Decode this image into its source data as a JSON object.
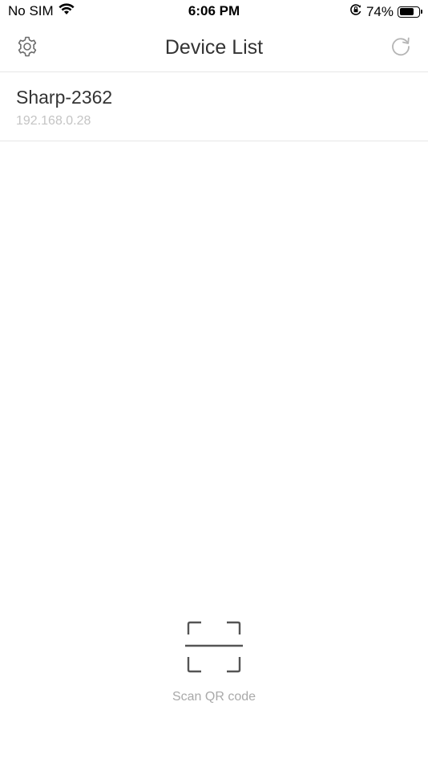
{
  "status_bar": {
    "carrier": "No SIM",
    "time": "6:06 PM",
    "battery_percent": "74%",
    "battery_level": 0.74,
    "icons": [
      "wifi-icon",
      "orientation-lock-icon",
      "battery-icon"
    ]
  },
  "header": {
    "title": "Device List",
    "left_icon": "settings-gear-icon",
    "right_icon": "refresh-icon"
  },
  "devices": [
    {
      "name": "Sharp-2362",
      "ip": "192.168.0.28"
    }
  ],
  "scan": {
    "label": "Scan QR code",
    "icon": "qr-scan-icon"
  },
  "colors": {
    "title_text": "#333333",
    "secondary_text": "#c4c4c4",
    "divider": "#e6e6e6",
    "icon_gray": "#6b6b6b"
  }
}
